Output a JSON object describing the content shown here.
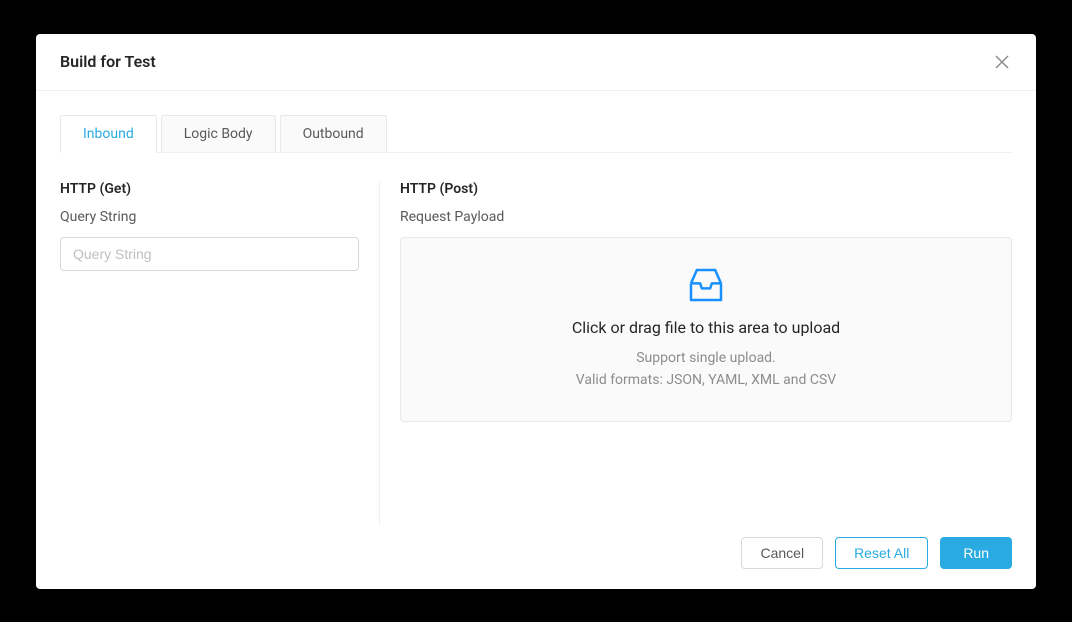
{
  "modal": {
    "title": "Build for Test"
  },
  "tabs": [
    {
      "label": "Inbound",
      "active": true
    },
    {
      "label": "Logic Body",
      "active": false
    },
    {
      "label": "Outbound",
      "active": false
    }
  ],
  "left": {
    "title": "HTTP (Get)",
    "label": "Query String",
    "placeholder": "Query String",
    "value": ""
  },
  "right": {
    "title": "HTTP (Post)",
    "label": "Request Payload",
    "upload": {
      "title": "Click or drag file to this area to upload",
      "hint1": "Support single upload.",
      "hint2": "Valid formats: JSON, YAML, XML and CSV"
    }
  },
  "footer": {
    "cancel": "Cancel",
    "reset": "Reset All",
    "run": "Run"
  }
}
